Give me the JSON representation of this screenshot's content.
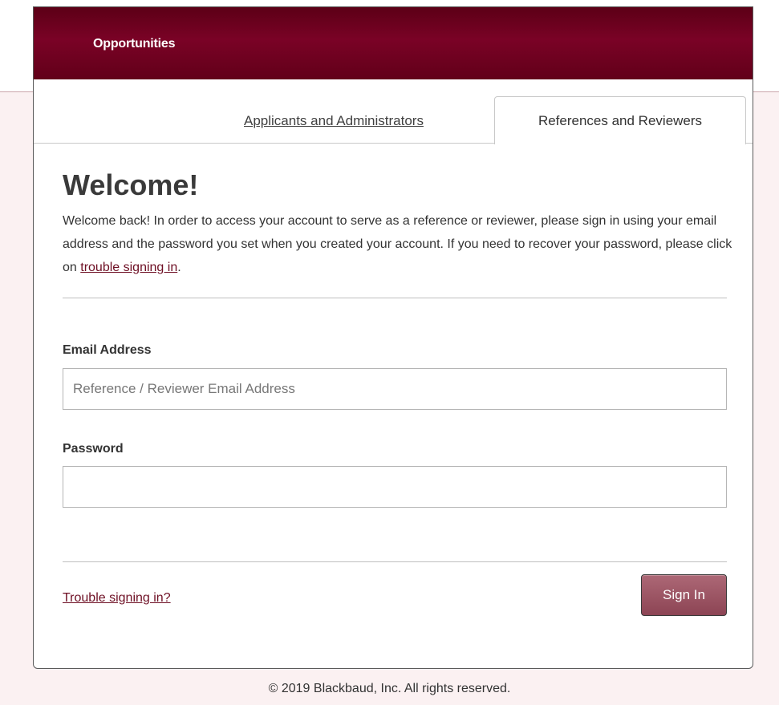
{
  "header": {
    "title": "Opportunities"
  },
  "tabs": [
    {
      "label": "Applicants and Administrators",
      "active": false
    },
    {
      "label": "References and Reviewers",
      "active": true
    }
  ],
  "welcome": {
    "title": "Welcome!",
    "text": "Welcome back! In order to access your account to serve as a reference or reviewer, please sign in using your email address and the password you set when you created your account. If you need to recover your password, please click on ",
    "link": "trouble signing in",
    "text_end": "."
  },
  "form": {
    "email_label": "Email Address",
    "email_placeholder": "Reference / Reviewer Email Address",
    "email_value": "",
    "password_label": "Password",
    "password_value": ""
  },
  "actions": {
    "trouble_link": "Trouble signing in?",
    "signin_label": "Sign In"
  },
  "footer": {
    "copyright": "© 2019 Blackbaud, Inc. All rights reserved."
  },
  "colors": {
    "header_brand": "#7a0226",
    "link": "#6e0f24",
    "signin_button": "#9c5665",
    "page_band": "#fbf1f2"
  }
}
